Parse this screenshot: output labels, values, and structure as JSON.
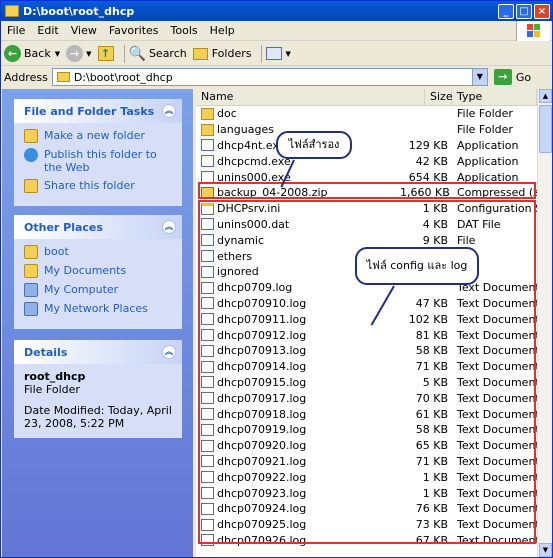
{
  "window": {
    "title": "D:\\boot\\root_dhcp"
  },
  "titlebar_buttons": {
    "minimize": "_",
    "maximize": "□",
    "close": "×"
  },
  "menu": [
    "File",
    "Edit",
    "View",
    "Favorites",
    "Tools",
    "Help"
  ],
  "toolbar": {
    "back": "Back",
    "search": "Search",
    "folders": "Folders"
  },
  "address": {
    "label": "Address",
    "value": "D:\\boot\\root_dhcp",
    "go": "Go"
  },
  "tasks": {
    "title": "File and Folder Tasks",
    "items": [
      "Make a new folder",
      "Publish this folder to the Web",
      "Share this folder"
    ]
  },
  "other_places": {
    "title": "Other Places",
    "items": [
      "boot",
      "My Documents",
      "My Computer",
      "My Network Places"
    ]
  },
  "details": {
    "title": "Details",
    "name": "root_dhcp",
    "type": "File Folder",
    "modified": "Date Modified: Today, April 23, 2008, 5:22 PM"
  },
  "columns": {
    "name": "Name",
    "size": "Size",
    "type": "Type"
  },
  "files": [
    {
      "name": "doc",
      "size": "",
      "type": "File Folder",
      "icon": "folder"
    },
    {
      "name": "languages",
      "size": "",
      "type": "File Folder",
      "icon": "folder"
    },
    {
      "name": "dhcp4nt.exe",
      "size": "129 KB",
      "type": "Application",
      "icon": "app"
    },
    {
      "name": "dhcpcmd.exe",
      "size": "42 KB",
      "type": "Application",
      "icon": "app"
    },
    {
      "name": "unins000.exe",
      "size": "654 KB",
      "type": "Application",
      "icon": "app"
    },
    {
      "name": "backup_04-2008.zip",
      "size": "1,660 KB",
      "type": "Compressed (zipp",
      "icon": "zip"
    },
    {
      "name": "DHCPsrv.ini",
      "size": "1 KB",
      "type": "Configuration Sett",
      "icon": "ini"
    },
    {
      "name": "unins000.dat",
      "size": "4 KB",
      "type": "DAT File",
      "icon": "app"
    },
    {
      "name": "dynamic",
      "size": "9 KB",
      "type": "File",
      "icon": "app"
    },
    {
      "name": "ethers",
      "size": "",
      "type": "",
      "icon": "app"
    },
    {
      "name": "ignored",
      "size": "",
      "type": "",
      "icon": "app"
    },
    {
      "name": "dhcp0709.log",
      "size": "",
      "type": "Text Document",
      "icon": "doc"
    },
    {
      "name": "dhcp070910.log",
      "size": "47 KB",
      "type": "Text Document",
      "icon": "doc"
    },
    {
      "name": "dhcp070911.log",
      "size": "102 KB",
      "type": "Text Document",
      "icon": "doc"
    },
    {
      "name": "dhcp070912.log",
      "size": "81 KB",
      "type": "Text Document",
      "icon": "doc"
    },
    {
      "name": "dhcp070913.log",
      "size": "58 KB",
      "type": "Text Document",
      "icon": "doc"
    },
    {
      "name": "dhcp070914.log",
      "size": "71 KB",
      "type": "Text Document",
      "icon": "doc"
    },
    {
      "name": "dhcp070915.log",
      "size": "5 KB",
      "type": "Text Document",
      "icon": "doc"
    },
    {
      "name": "dhcp070917.log",
      "size": "70 KB",
      "type": "Text Document",
      "icon": "doc"
    },
    {
      "name": "dhcp070918.log",
      "size": "61 KB",
      "type": "Text Document",
      "icon": "doc"
    },
    {
      "name": "dhcp070919.log",
      "size": "58 KB",
      "type": "Text Document",
      "icon": "doc"
    },
    {
      "name": "dhcp070920.log",
      "size": "65 KB",
      "type": "Text Document",
      "icon": "doc"
    },
    {
      "name": "dhcp070921.log",
      "size": "71 KB",
      "type": "Text Document",
      "icon": "doc"
    },
    {
      "name": "dhcp070922.log",
      "size": "1 KB",
      "type": "Text Document",
      "icon": "doc"
    },
    {
      "name": "dhcp070923.log",
      "size": "1 KB",
      "type": "Text Document",
      "icon": "doc"
    },
    {
      "name": "dhcp070924.log",
      "size": "76 KB",
      "type": "Text Document",
      "icon": "doc"
    },
    {
      "name": "dhcp070925.log",
      "size": "73 KB",
      "type": "Text Document",
      "icon": "doc"
    },
    {
      "name": "dhcp070926.log",
      "size": "67 KB",
      "type": "Text Document",
      "icon": "doc"
    }
  ],
  "annotations": {
    "backup": "ไฟล์สำรอง",
    "config": "ไฟล์ config และ log"
  },
  "colors": {
    "highlight": "#e03030",
    "bubble_border": "#203080",
    "task_link": "#215dc6"
  }
}
